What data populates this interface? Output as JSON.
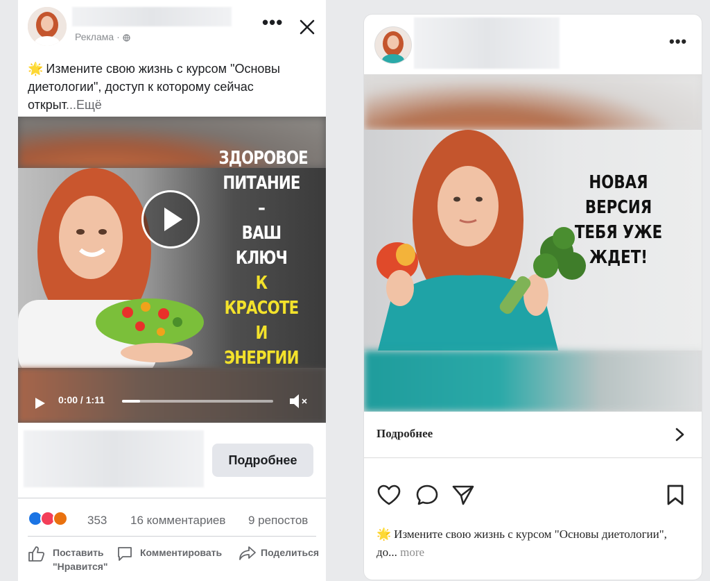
{
  "fb_ad": {
    "sponsored_label": "Реклама",
    "sponsored_dot": "·",
    "more_label": "•••",
    "caption_emoji": "🌟",
    "caption_text": "Измените свою жизнь с курсом \"Основы диетологии\", доступ к которому сейчас открыт",
    "caption_more": "...Ещё",
    "video": {
      "headline_white": [
        "ЗДОРОВОЕ",
        "ПИТАНИЕ –",
        "ВАШ КЛЮЧ"
      ],
      "headline_yellow": [
        "К КРАСОТЕ",
        "И ЭНЕРГИИ"
      ],
      "time": "0:00 / 1:11",
      "progress": 0.12
    },
    "cta_label": "Подробнее",
    "reaction_count": "353",
    "comments": "16 комментариев",
    "shares": "9 репостов",
    "actions": {
      "like_line1": "Поставить",
      "like_line2": "\"Нравится\"",
      "comment": "Комментировать",
      "share": "Поделиться"
    }
  },
  "ig_ad": {
    "more_label": "•••",
    "headline": [
      "НОВАЯ ВЕРСИЯ",
      "ТЕБЯ УЖЕ ЖДЕТ!"
    ],
    "more_row_label": "Подробнее",
    "caption_emoji": "🌟",
    "caption_text": "Измените свою жизнь с курсом \"Основы диетологии\", до...",
    "caption_more": "more"
  },
  "colors": {
    "fb_blue": "#1b74e4",
    "headline_yellow": "#f3e22b",
    "ig_text": "#262626"
  }
}
